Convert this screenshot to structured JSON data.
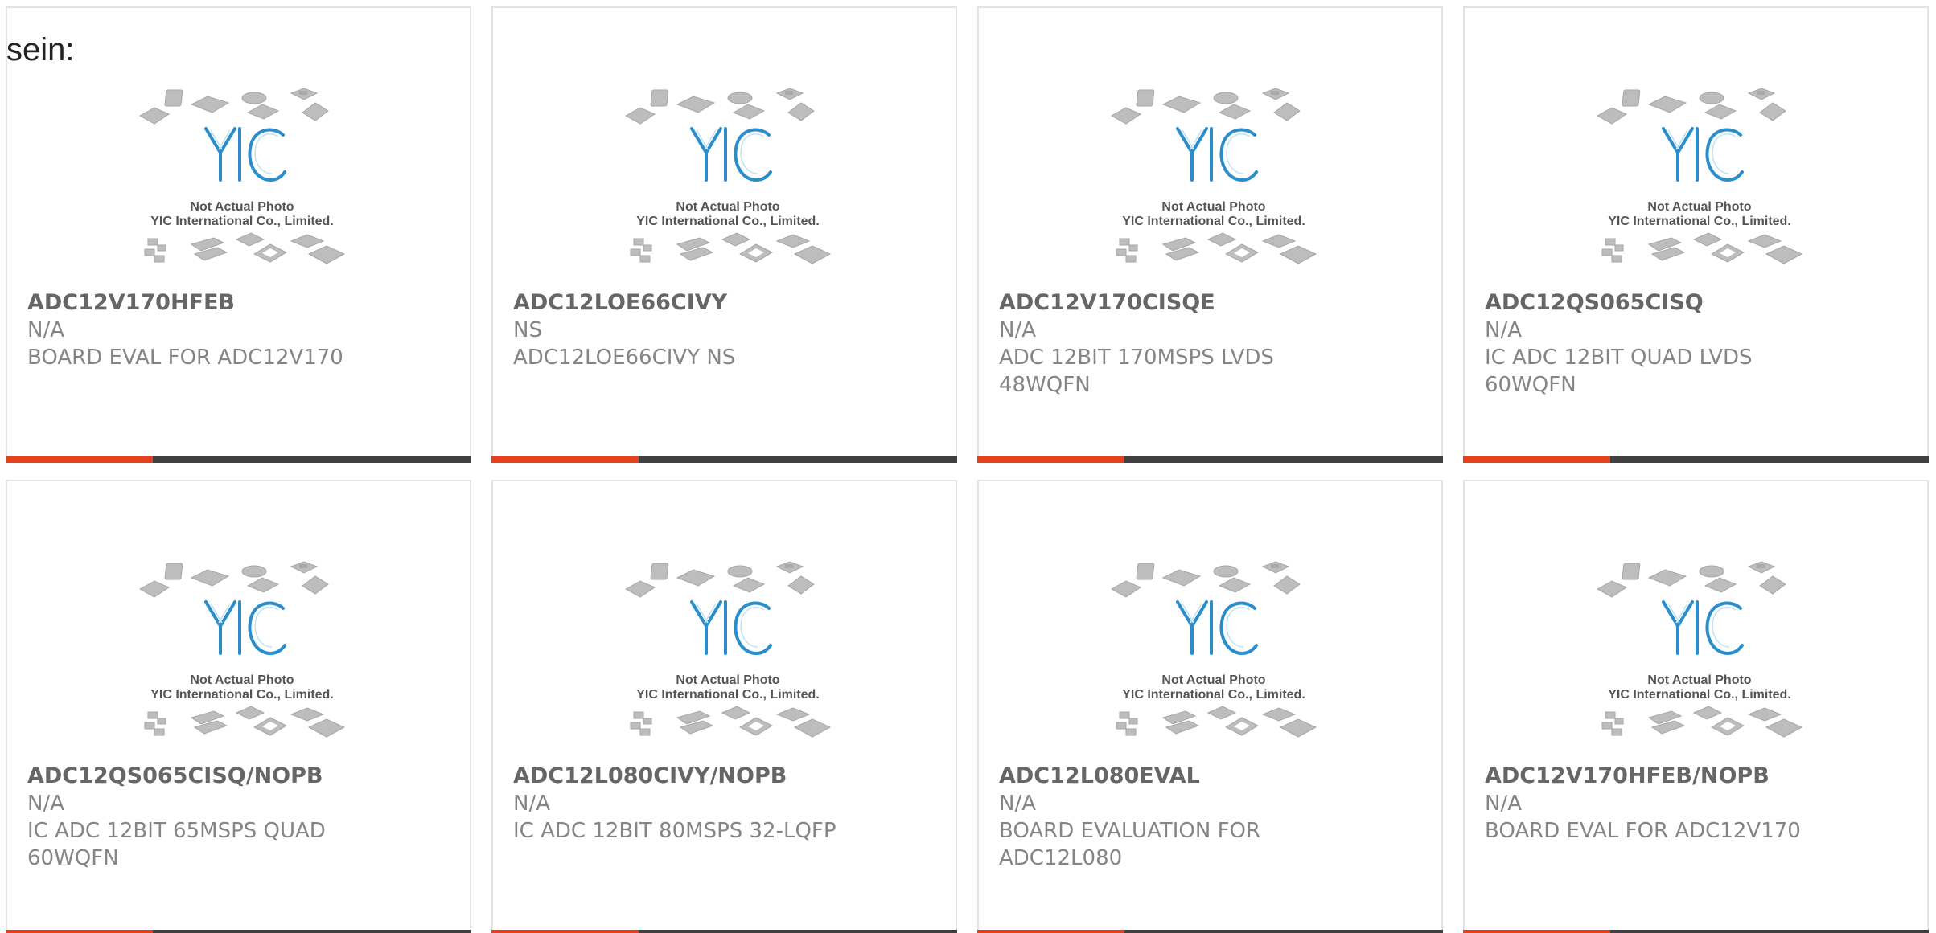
{
  "page": {
    "heading": "sein:"
  },
  "placeholder": {
    "logo": "YIC",
    "line1": "Not Actual Photo",
    "line2": "YIC International Co., Limited."
  },
  "colors": {
    "accent": "#e5411c",
    "bar": "#3f3f3f",
    "border": "#e3e3e3",
    "logo": "#2a8dcc"
  },
  "products": [
    {
      "part": "ADC12V170HFEB",
      "manufacturer": "N/A",
      "description": "BOARD EVAL FOR ADC12V170"
    },
    {
      "part": "ADC12LOE66CIVY",
      "manufacturer": "NS",
      "description": "ADC12LOE66CIVY NS"
    },
    {
      "part": "ADC12V170CISQE",
      "manufacturer": "N/A",
      "description": "ADC 12BIT 170MSPS LVDS 48WQFN"
    },
    {
      "part": "ADC12QS065CISQ",
      "manufacturer": "N/A",
      "description": "IC ADC 12BIT QUAD LVDS 60WQFN"
    },
    {
      "part": "ADC12QS065CISQ/NOPB",
      "manufacturer": "N/A",
      "description": "IC ADC 12BIT 65MSPS QUAD 60WQFN"
    },
    {
      "part": "ADC12L080CIVY/NOPB",
      "manufacturer": "N/A",
      "description": "IC ADC 12BIT 80MSPS 32-LQFP"
    },
    {
      "part": "ADC12L080EVAL",
      "manufacturer": "N/A",
      "description": "BOARD EVALUATION FOR ADC12L080"
    },
    {
      "part": "ADC12V170HFEB/NOPB",
      "manufacturer": "N/A",
      "description": "BOARD EVAL FOR ADC12V170"
    }
  ]
}
